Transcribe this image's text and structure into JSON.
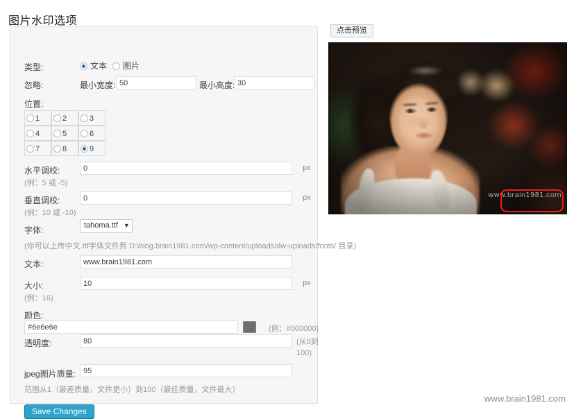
{
  "page": {
    "title": "图片水印选项",
    "footer_url": "www.brain1981.com"
  },
  "form": {
    "type": {
      "label": "类型:",
      "options": [
        {
          "label": "文本",
          "selected": true
        },
        {
          "label": "图片",
          "selected": false
        }
      ]
    },
    "ignore": {
      "label": "忽略:",
      "min_width_label": "最小宽度:",
      "min_width_value": "50",
      "min_height_label": "最小高度:",
      "min_height_value": "30"
    },
    "position": {
      "label": "位置:",
      "cells": [
        "1",
        "2",
        "3",
        "4",
        "5",
        "6",
        "7",
        "8",
        "9"
      ],
      "selected": "9"
    },
    "horizontal_offset": {
      "label": "水平调校:",
      "value": "0",
      "unit": "px",
      "hint": "(例：5 或 -5)"
    },
    "vertical_offset": {
      "label": "垂直调校:",
      "value": "0",
      "unit": "px",
      "hint": "(例：10 或 -10)"
    },
    "font": {
      "label": "字体:",
      "selected": "tahoma.ttf",
      "options": [
        "tahoma.ttf"
      ],
      "hint": "(你可以上传中文.ttf字体文件到 D:\\blog.brain1981.com/wp-content/uploads/dw-uploads/fonts/ 目录)"
    },
    "text": {
      "label": "文本:",
      "value": "www.brain1981.com"
    },
    "size": {
      "label": "大小:",
      "value": "10",
      "unit": "px",
      "hint": "(例：16)"
    },
    "color": {
      "label": "颜色:",
      "value": "#6e6e6e",
      "swatch": "#6e6e6e",
      "hint": "(例：#000000)"
    },
    "opacity": {
      "label": "透明度:",
      "value": "80",
      "hint": "(从0到100)"
    },
    "jpeg_quality": {
      "label": "jpeg图片质量:",
      "value": "95",
      "hint": "范围从1（最差质量，文件更小）到100（最佳质量，文件最大）"
    },
    "save_label": "Save Changes"
  },
  "preview": {
    "button_label": "点击预览",
    "watermark_text": "www.brain1981.com",
    "annotation_color": "#e81d1d"
  }
}
